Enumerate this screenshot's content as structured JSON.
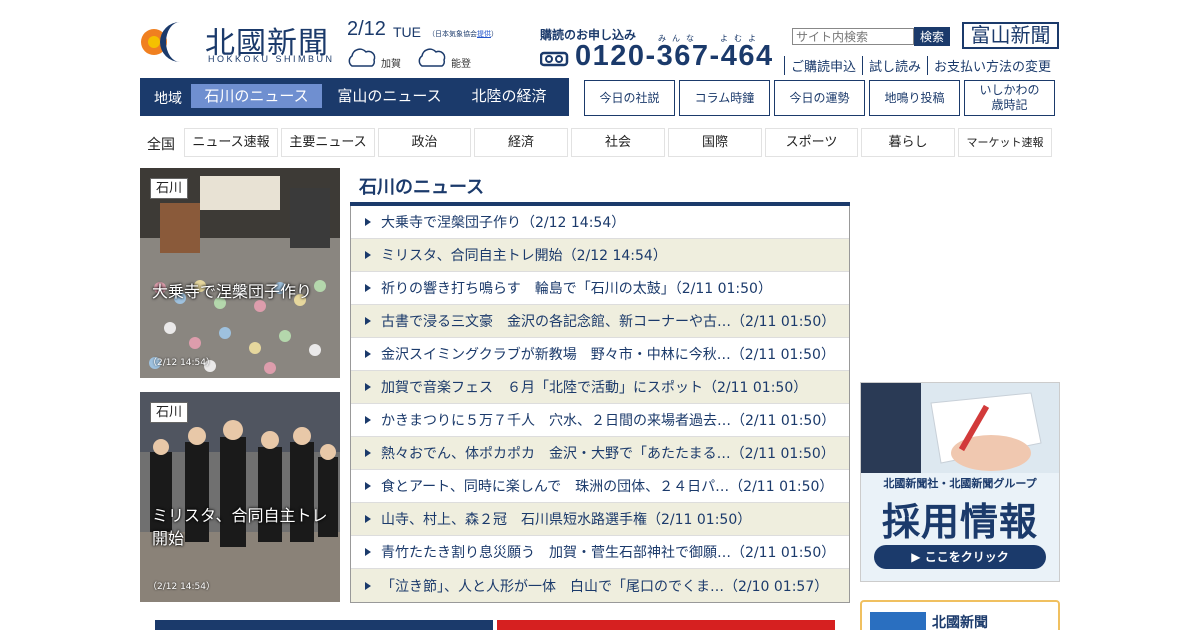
{
  "header": {
    "logo_text": "北國新聞",
    "logo_en": "HOKKOKU SHIMBUN",
    "date": "2/12",
    "weekday": "TUE",
    "weather_source_prefix": "（日本気象協会",
    "weather_source_link": "提供",
    "weather_source_suffix": "）",
    "weather": [
      {
        "area": "加賀",
        "icon": "cloud-icon"
      },
      {
        "area": "能登",
        "icon": "cloud-icon"
      }
    ],
    "subscribe_title": "購読のお申し込み",
    "subscribe_ruby1": "みんな",
    "subscribe_ruby2": "よむよ",
    "phone": "0120-367-464",
    "search_placeholder": "サイト内検索",
    "search_button": "検索",
    "toyama_logo": "富山新聞",
    "links": [
      "ご購読申込",
      "試し読み",
      "お支払い方法の変更"
    ]
  },
  "region_nav": {
    "label": "地域",
    "tabs": [
      "石川のニュース",
      "富山のニュース",
      "北陸の経済"
    ]
  },
  "box_links": [
    "今日の社説",
    "コラム時鐘",
    "今日の運勢",
    "地鳴り投稿",
    "いしかわの\n歳時記"
  ],
  "categories": {
    "all": "全国",
    "items": [
      "ニュース速報",
      "主要ニュース",
      "政治",
      "経済",
      "社会",
      "国際",
      "スポーツ",
      "暮らし",
      "マーケット速報"
    ]
  },
  "photo_cards": [
    {
      "tag": "石川",
      "title": "大乗寺で涅槃団子作り",
      "time": "（2/12 14:54）"
    },
    {
      "tag": "石川",
      "title": "ミリスタ、合同自主トレ開始",
      "time": "（2/12 14:54）"
    }
  ],
  "news": {
    "title": "石川のニュース",
    "items": [
      "大乗寺で涅槃団子作り（2/12 14:54）",
      "ミリスタ、合同自主トレ開始（2/12 14:54）",
      "祈りの響き打ち鳴らす　輪島で「石川の太鼓」（2/11 01:50）",
      "古書で浸る三文豪　金沢の各記念館、新コーナーや古…（2/11 01:50）",
      "金沢スイミングクラブが新教場　野々市・中林に今秋…（2/11 01:50）",
      "加賀で音楽フェス　６月「北陸で活動」にスポット（2/11 01:50）",
      "かきまつりに５万７千人　穴水、２日間の来場者過去…（2/11 01:50）",
      "熱々おでん、体ポカポカ　金沢・大野で「あたたまる…（2/11 01:50）",
      "食とアート、同時に楽しんで　珠洲の団体、２４日パ…（2/11 01:50）",
      "山寺、村上、森２冠　石川県短水路選手権（2/11 01:50）",
      "青竹たたき割り息災願う　加賀・菅生石部神社で御願…（2/11 01:50）",
      "「泣き節」、人と人形が一体　白山で「尾口のでくま…（2/10 01:57）"
    ]
  },
  "ads": {
    "recruit_sub": "北國新聞社・北國新聞グループ",
    "recruit_main": "採用情報",
    "recruit_button": "▶ ここをクリック",
    "bottom_ad_text": "北國新聞"
  },
  "colors": {
    "brand": "#1b3a6b",
    "accent": "#6f8fd0",
    "stripe": "#efeede"
  }
}
